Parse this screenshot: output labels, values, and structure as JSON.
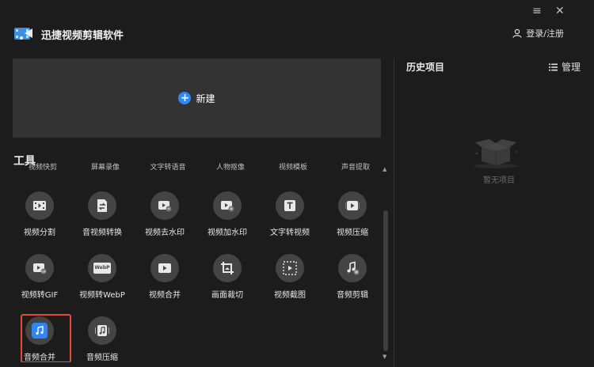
{
  "app": {
    "title": "迅捷视频剪辑软件"
  },
  "window": {
    "menu_icon": "≡",
    "close_icon": "✕"
  },
  "header": {
    "login_label": "登录/注册"
  },
  "new_project": {
    "label": "新建"
  },
  "tools": {
    "title": "工具",
    "partial_row": [
      "视频快剪",
      "屏幕录像",
      "文字转语音",
      "人物抠像",
      "视频模板",
      "声音提取"
    ],
    "items": [
      {
        "label": "视频分割",
        "icon": "film-split-icon"
      },
      {
        "label": "音视频转换",
        "icon": "convert-icon"
      },
      {
        "label": "视频去水印",
        "icon": "remove-watermark-icon"
      },
      {
        "label": "视频加水印",
        "icon": "add-watermark-icon"
      },
      {
        "label": "文字转视频",
        "icon": "text-to-video-icon"
      },
      {
        "label": "视频压缩",
        "icon": "video-compress-icon"
      },
      {
        "label": "视频转GIF",
        "icon": "video-to-gif-icon"
      },
      {
        "label": "视频转WebP",
        "icon": "video-to-webp-icon"
      },
      {
        "label": "视频合并",
        "icon": "video-merge-icon"
      },
      {
        "label": "画面裁切",
        "icon": "crop-icon"
      },
      {
        "label": "视频截图",
        "icon": "screenshot-icon"
      },
      {
        "label": "音频剪辑",
        "icon": "audio-edit-icon"
      },
      {
        "label": "音频合并",
        "icon": "audio-merge-icon"
      },
      {
        "label": "音频压缩",
        "icon": "audio-compress-icon"
      }
    ],
    "selected": "音频合并",
    "webp_badge": "WebP"
  },
  "history": {
    "title": "历史项目",
    "manage_label": "管理",
    "empty_text": "暂无项目"
  },
  "colors": {
    "accent": "#2f86f6",
    "selection": "#e24a3b",
    "background": "#1c1c1c",
    "panel": "#333333"
  }
}
